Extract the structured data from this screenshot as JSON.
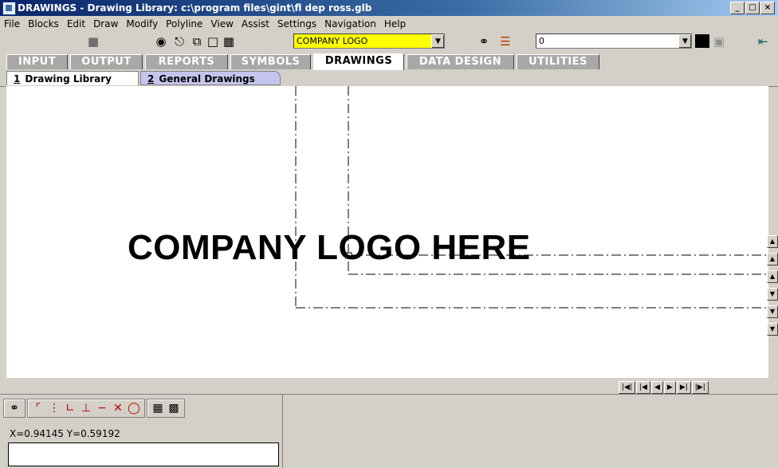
{
  "window": {
    "title": "DRAWINGS - Drawing Library:  c:\\program files\\gint\\fl dep ross.glb",
    "buttons": [
      "_",
      "□",
      "×"
    ]
  },
  "menu": [
    "File",
    "Blocks",
    "Edit",
    "Draw",
    "Modify",
    "Polyline",
    "View",
    "Assist",
    "Settings",
    "Navigation",
    "Help"
  ],
  "toolbar": {
    "layer_value": "COMPANY LOGO",
    "linetype_value": "0",
    "colors": {
      "layer_bg": "#ffff00",
      "swatch": "#000000"
    },
    "icons": [
      "save-icon",
      "view-icon",
      "print-icon",
      "copy-icon",
      "new-page-icon",
      "properties-icon",
      "lock-icon",
      "layers-icon",
      "exit-icon"
    ]
  },
  "main_tabs": [
    "INPUT",
    "OUTPUT",
    "REPORTS",
    "SYMBOLS",
    "DRAWINGS",
    "DATA DESIGN",
    "UTILITIES"
  ],
  "main_tab_active": "DRAWINGS",
  "sub_tabs": [
    {
      "num": "1",
      "label": "Drawing Library"
    },
    {
      "num": "2",
      "label": "General Drawings"
    }
  ],
  "canvas": {
    "logo_text": "COMPANY LOGO HERE"
  },
  "status": {
    "coords": "X=0.94145   Y=0.59192"
  }
}
